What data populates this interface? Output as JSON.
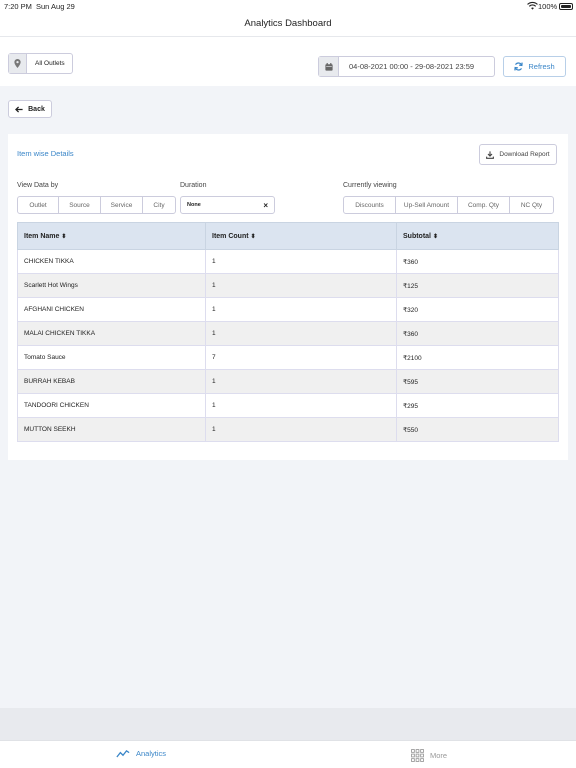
{
  "status_bar": {
    "time": "7:20 PM",
    "date": "Sun Aug 29",
    "battery": "100%"
  },
  "nav": {
    "title": "Analytics Dashboard"
  },
  "filters": {
    "outlet_label": "All Outlets",
    "date_range": "04-08-2021 00:00 - 29-08-2021 23:59",
    "refresh_label": "Refresh"
  },
  "back_label": "Back",
  "card": {
    "title": "Item wise Details",
    "download_label": "Download Report",
    "view_by_label": "View Data by",
    "view_by_options": [
      "Outlet",
      "Source",
      "Service",
      "City"
    ],
    "duration_label": "Duration",
    "duration_value": "None",
    "viewing_label": "Currently viewing",
    "viewing_options": [
      "Discounts",
      "Up-Sell Amount",
      "Comp. Qty",
      "NC Qty"
    ]
  },
  "table": {
    "columns": [
      "Item Name",
      "Item Count",
      "Subtotal"
    ],
    "rows": [
      [
        "CHICKEN TIKKA",
        "1",
        "₹360"
      ],
      [
        "Scarlett Hot Wings",
        "1",
        "₹125"
      ],
      [
        "AFGHANI CHICKEN",
        "1",
        "₹320"
      ],
      [
        "MALAI CHICKEN TIKKA",
        "1",
        "₹360"
      ],
      [
        "Tomato Sauce",
        "7",
        "₹2100"
      ],
      [
        "BURRAH KEBAB",
        "1",
        "₹595"
      ],
      [
        "TANDOORI CHICKEN",
        "1",
        "₹295"
      ],
      [
        "MUTTON SEEKH",
        "1",
        "₹550"
      ]
    ]
  },
  "tabs": {
    "analytics": "Analytics",
    "more": "More"
  },
  "colors": {
    "accent": "#3a86c8",
    "table_header": "#dbe4f0",
    "row_alt": "#f0f0f0"
  },
  "icons": [
    "wifi-icon",
    "battery-icon",
    "location-pin-icon",
    "calendar-icon",
    "refresh-icon",
    "arrow-left-icon",
    "download-icon",
    "sort-icon",
    "clear-icon",
    "analytics-chart-icon",
    "grid-icon"
  ]
}
